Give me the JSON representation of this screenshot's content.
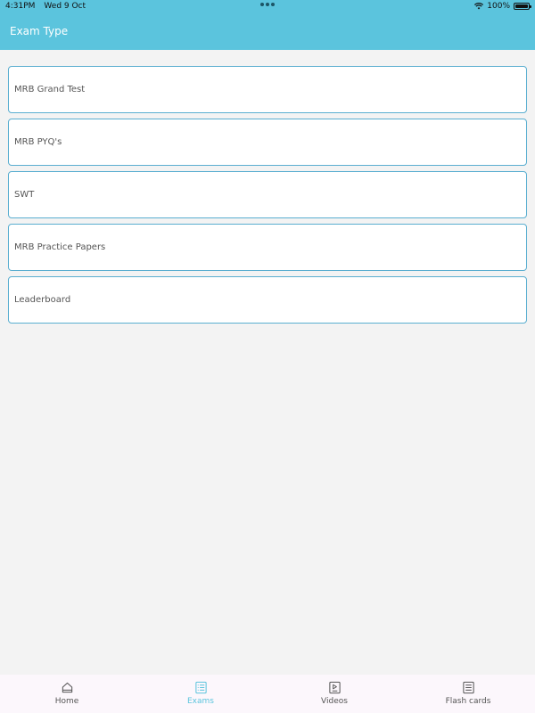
{
  "status_bar": {
    "time": "4:31PM",
    "date": "Wed 9 Oct",
    "battery": "100%",
    "icons": [
      "wifi-icon",
      "battery-icon"
    ]
  },
  "header": {
    "title": "Exam Type"
  },
  "exam_types": [
    {
      "label": "MRB Grand Test"
    },
    {
      "label": "MRB PYQ's"
    },
    {
      "label": "SWT"
    },
    {
      "label": "MRB Practice Papers"
    },
    {
      "label": "Leaderboard"
    }
  ],
  "tabs": [
    {
      "label": "Home",
      "icon": "home-icon",
      "active": false
    },
    {
      "label": "Exams",
      "icon": "list-icon",
      "active": true
    },
    {
      "label": "Videos",
      "icon": "play-icon",
      "active": false
    },
    {
      "label": "Flash cards",
      "icon": "cards-icon",
      "active": false
    }
  ],
  "colors": {
    "accent": "#5bc4dd",
    "card_border": "#5aaed0",
    "background": "#f3f3f3",
    "tab_bar": "#fcf7fc"
  }
}
